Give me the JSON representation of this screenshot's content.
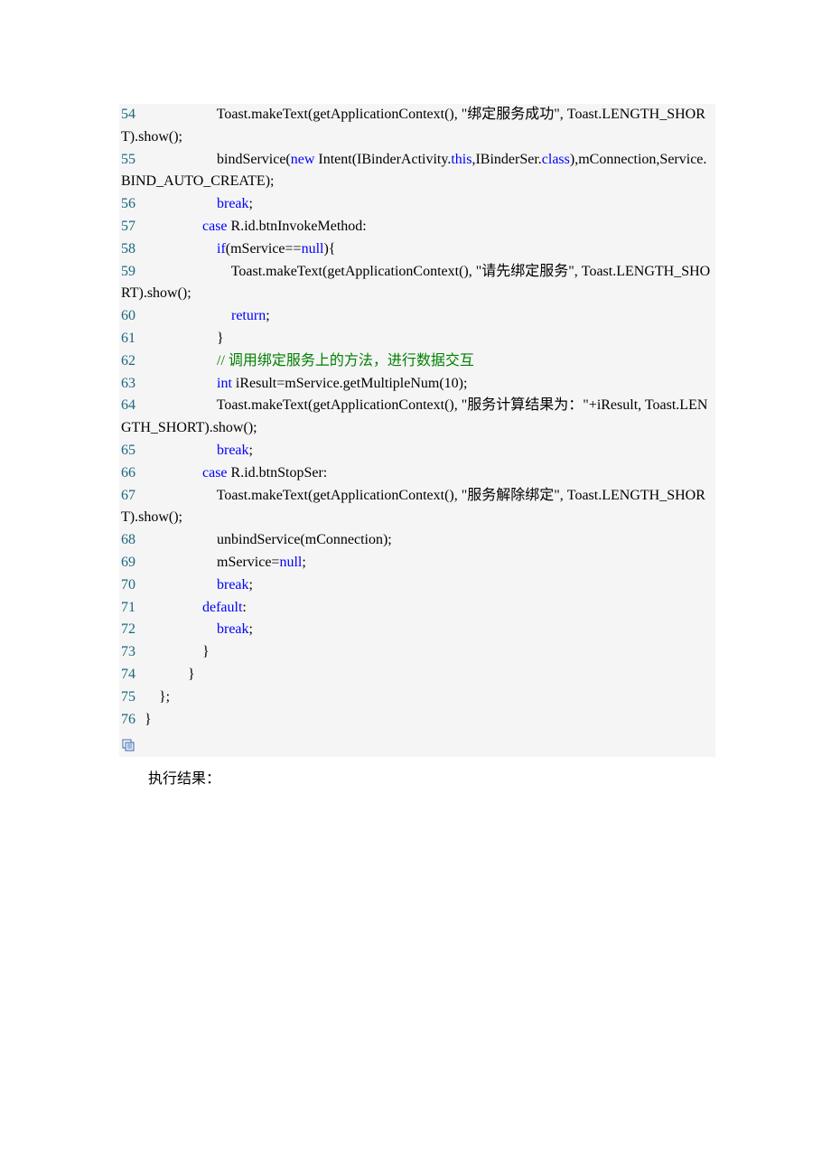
{
  "result_label": "执行结果：",
  "lines": [
    {
      "n": "54",
      "segs": [
        {
          "t": "                     Toast.makeText(getApplicationContext(), \"绑定服务成功\", Toast.LENGTH_SHORT).show();"
        }
      ]
    },
    {
      "n": "55",
      "segs": [
        {
          "t": "                     bindService("
        },
        {
          "t": "new",
          "c": "kw"
        },
        {
          "t": " Intent(IBinderActivity."
        },
        {
          "t": "this",
          "c": "kw"
        },
        {
          "t": ",IBinderSer."
        },
        {
          "t": "class",
          "c": "kw"
        },
        {
          "t": "),mConnection,Service.BIND_AUTO_CREATE);"
        }
      ]
    },
    {
      "n": "56",
      "segs": [
        {
          "t": "                     "
        },
        {
          "t": "break",
          "c": "kw"
        },
        {
          "t": ";"
        }
      ]
    },
    {
      "n": "57",
      "segs": [
        {
          "t": "                 "
        },
        {
          "t": "case",
          "c": "kw"
        },
        {
          "t": " R.id.btnInvokeMethod:"
        }
      ]
    },
    {
      "n": "58",
      "segs": [
        {
          "t": "                     "
        },
        {
          "t": "if",
          "c": "kw"
        },
        {
          "t": "(mService=="
        },
        {
          "t": "null",
          "c": "kw"
        },
        {
          "t": "){"
        }
      ]
    },
    {
      "n": "59",
      "segs": [
        {
          "t": "                         Toast.makeText(getApplicationContext(), \"请先绑定服务\", Toast.LENGTH_SHORT).show();"
        }
      ]
    },
    {
      "n": "60",
      "segs": [
        {
          "t": "                         "
        },
        {
          "t": "return",
          "c": "kw"
        },
        {
          "t": ";"
        }
      ]
    },
    {
      "n": "61",
      "segs": [
        {
          "t": "                     }"
        }
      ]
    },
    {
      "n": "62",
      "segs": [
        {
          "t": "                     "
        },
        {
          "t": "// 调用绑定服务上的方法，进行数据交互",
          "c": "cm"
        }
      ]
    },
    {
      "n": "63",
      "segs": [
        {
          "t": "                     "
        },
        {
          "t": "int",
          "c": "kw"
        },
        {
          "t": " iResult=mService.getMultipleNum(10);"
        }
      ]
    },
    {
      "n": "64",
      "segs": [
        {
          "t": "                     Toast.makeText(getApplicationContext(), \"服务计算结果为：\"+iResult, Toast.LENGTH_SHORT).show();"
        }
      ]
    },
    {
      "n": "65",
      "segs": [
        {
          "t": "                     "
        },
        {
          "t": "break",
          "c": "kw"
        },
        {
          "t": ";"
        }
      ]
    },
    {
      "n": "66",
      "segs": [
        {
          "t": "                 "
        },
        {
          "t": "case",
          "c": "kw"
        },
        {
          "t": " R.id.btnStopSer:"
        }
      ]
    },
    {
      "n": "67",
      "segs": [
        {
          "t": "                     Toast.makeText(getApplicationContext(), \"服务解除绑定\", Toast.LENGTH_SHORT).show();"
        }
      ]
    },
    {
      "n": "68",
      "segs": [
        {
          "t": "                     unbindService(mConnection);"
        }
      ]
    },
    {
      "n": "69",
      "segs": [
        {
          "t": "                     mService="
        },
        {
          "t": "null",
          "c": "kw"
        },
        {
          "t": ";"
        }
      ]
    },
    {
      "n": "70",
      "segs": [
        {
          "t": "                     "
        },
        {
          "t": "break",
          "c": "kw"
        },
        {
          "t": ";"
        }
      ]
    },
    {
      "n": "71",
      "segs": [
        {
          "t": "                 "
        },
        {
          "t": "default",
          "c": "kw"
        },
        {
          "t": ":"
        }
      ]
    },
    {
      "n": "72",
      "segs": [
        {
          "t": "                     "
        },
        {
          "t": "break",
          "c": "kw"
        },
        {
          "t": ";"
        }
      ]
    },
    {
      "n": "73",
      "segs": [
        {
          "t": "                 }"
        }
      ]
    },
    {
      "n": "74",
      "segs": [
        {
          "t": "             }"
        }
      ]
    },
    {
      "n": "75",
      "segs": [
        {
          "t": "     };"
        }
      ]
    },
    {
      "n": "76",
      "segs": [
        {
          "t": " }"
        }
      ]
    }
  ]
}
